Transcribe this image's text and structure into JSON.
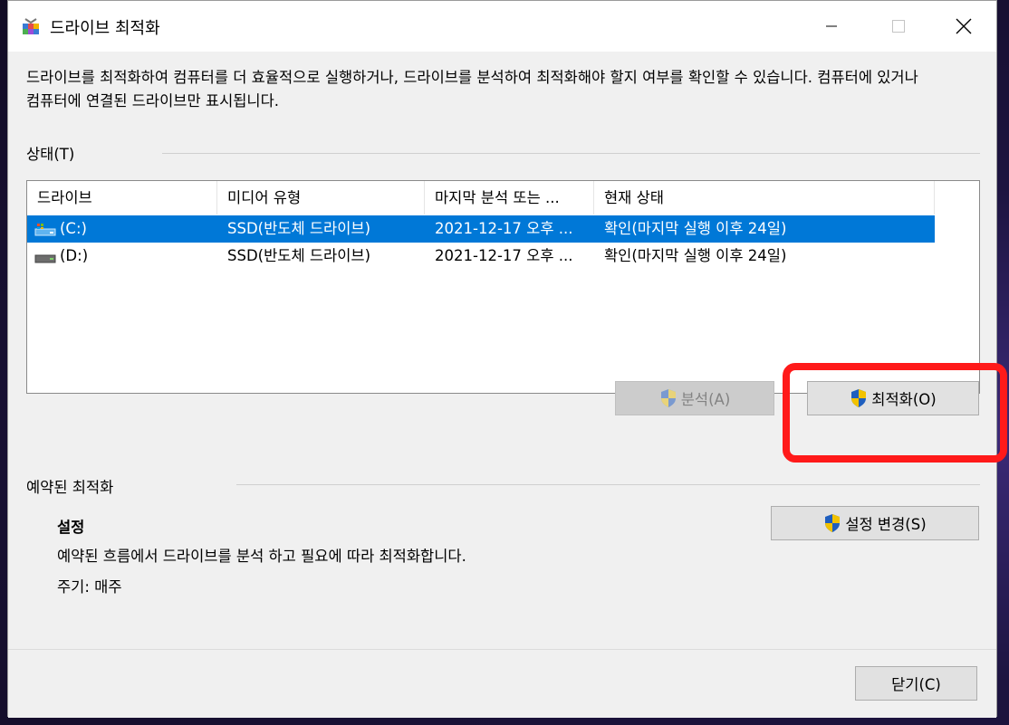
{
  "window": {
    "title": "드라이브 최적화",
    "icon": "defrag-app-icon"
  },
  "description": "드라이브를 최적화하여 컴퓨터를 더 효율적으로 실행하거나, 드라이브를 분석하여 최적화해야 할지 여부를 확인할 수 있습니다. 컴퓨터에 있거나 컴퓨터에 연결된 드라이브만 표시됩니다.",
  "status": {
    "label": "상태(T)",
    "columns": [
      "드라이브",
      "미디어 유형",
      "마지막 분석 또는 ...",
      "현재 상태"
    ],
    "rows": [
      {
        "drive": "(C:)",
        "media": "SSD(반도체 드라이브)",
        "last": "2021-12-17 오후 ...",
        "state": "확인(마지막 실행 이후 24일)",
        "selected": true,
        "icon": "system-drive-icon"
      },
      {
        "drive": "(D:)",
        "media": "SSD(반도체 드라이브)",
        "last": "2021-12-17 오후 ...",
        "state": "확인(마지막 실행 이후 24일)",
        "selected": false,
        "icon": "drive-icon"
      }
    ],
    "analyze_label": "분석(A)",
    "optimize_label": "최적화(O)"
  },
  "scheduled": {
    "label": "예약된 최적화",
    "settings_title": "설정",
    "settings_desc": "예약된 흐름에서 드라이브를 분석 하고 필요에 따라 최적화합니다.",
    "frequency": "주기: 매주",
    "change_label": "설정 변경(S)"
  },
  "footer": {
    "close_label": "닫기(C)"
  },
  "colors": {
    "selection": "#0078d7",
    "highlight": "#ff1a1a",
    "shield_blue": "#1f5fbf",
    "shield_yellow": "#f2c200"
  }
}
